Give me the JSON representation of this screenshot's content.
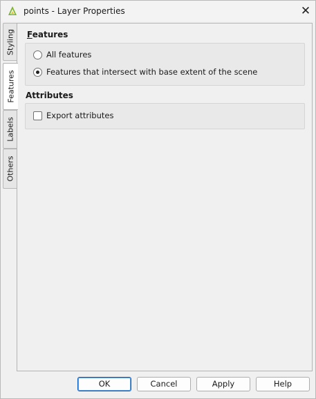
{
  "window": {
    "title": "points - Layer Properties",
    "app_icon": "qgis-logo-icon",
    "close_icon": "close-icon"
  },
  "tabs": [
    {
      "label": "Styling",
      "active": false
    },
    {
      "label": "Features",
      "active": true
    },
    {
      "label": "Labels",
      "active": false
    },
    {
      "label": "Others",
      "active": false
    }
  ],
  "features": {
    "title_mnemonic": "F",
    "title_rest": "eatures",
    "options": [
      {
        "label": "All features",
        "selected": false
      },
      {
        "label": "Features that intersect with base extent of the scene",
        "selected": true
      }
    ]
  },
  "attributes": {
    "title": "Attributes",
    "export_label": "Export attributes",
    "export_checked": false
  },
  "buttons": {
    "ok": "OK",
    "cancel": "Cancel",
    "apply": "Apply",
    "help": "Help"
  }
}
